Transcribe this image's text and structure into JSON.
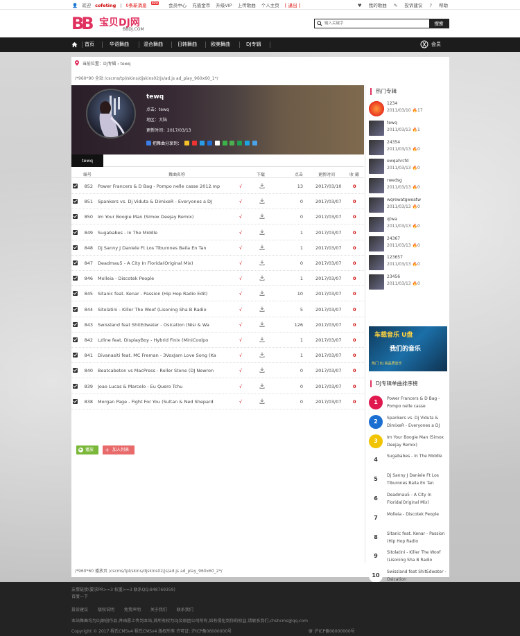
{
  "topbar": {
    "welcome": "欢迎",
    "user": "cofeting",
    "sep": "|",
    "new_msg": "0条新消息",
    "new_badge": "NEW",
    "links": [
      "会员中心",
      "充值金币",
      "升级VIP",
      "上传歌曲",
      "个人主页"
    ],
    "logout": "[ 退出 ]",
    "right": [
      "我的歌曲",
      "投诉建议",
      "帮助"
    ]
  },
  "header": {
    "logo_mark": "BB",
    "logo_cn": "宝贝DJ网",
    "logo_en": "BBDJ.COM",
    "search_placeholder": "输入关键字",
    "search_button": "搜索"
  },
  "nav": {
    "items": [
      "首页",
      "华语舞曲",
      "混合舞曲",
      "日韩舞曲",
      "欧美舞曲",
      "DJ专辑"
    ],
    "member": "会员"
  },
  "breadcrumb": {
    "label": "当前位置：",
    "path": "DJ专辑 › tewq"
  },
  "ad_top": "/*960*90 全站 /cscms/tpl/skins/djskins02/js/ad.js ad_play_960x60_1*/",
  "album": {
    "title": "tewq",
    "clicks": "点击：tewq",
    "region": "地区：大陆",
    "updated": "更新时间：2017/03/13",
    "share_label": "把舞曲分享到：",
    "tab": "tewq"
  },
  "table": {
    "headers": {
      "num": "编号",
      "name": "舞曲名称",
      "dl": "下载",
      "click": "点击",
      "time": "更新时间",
      "fav": "收 藏"
    },
    "rows": [
      {
        "num": "852",
        "name": "Power Francers & D Bag - Pompo nelle casse 2012.mp",
        "check": "√",
        "count": "13",
        "date": "2017/03/10",
        "fav": "0"
      },
      {
        "num": "851",
        "name": "Spankers vs. Dj Viduta & DimixeR - Everyones a DJ",
        "check": "√",
        "count": "0",
        "date": "2017/03/07",
        "fav": "0"
      },
      {
        "num": "850",
        "name": "Im Your Boogie Man (Simox Deejay Remix)",
        "check": "√",
        "count": "0",
        "date": "2017/03/07",
        "fav": "0"
      },
      {
        "num": "849",
        "name": "Sugababes - In The Middle",
        "check": "√",
        "count": "1",
        "date": "2017/03/07",
        "fav": "0"
      },
      {
        "num": "848",
        "name": "Dj Sanny J Daniele Ft Los Tiburones Baila En Tan",
        "check": "√",
        "count": "1",
        "date": "2017/03/07",
        "fav": "0"
      },
      {
        "num": "847",
        "name": "Deadmau5 - A City In Florida(Original Mix)",
        "check": "√",
        "count": "0",
        "date": "2017/03/07",
        "fav": "0"
      },
      {
        "num": "846",
        "name": "Molleia - Discotek People",
        "check": "√",
        "count": "1",
        "date": "2017/03/07",
        "fav": "0"
      },
      {
        "num": "845",
        "name": "Sitanic feat. Kenar - Passion (Hip Hop Radio Edit)",
        "check": "√",
        "count": "10",
        "date": "2017/03/07",
        "fav": "0"
      },
      {
        "num": "844",
        "name": "Sitolatini - Killer The Woof (Lisoning Sha B Radio",
        "check": "√",
        "count": "5",
        "date": "2017/03/07",
        "fav": "0"
      },
      {
        "num": "843",
        "name": "Swissland feat ShitEdwater - Osication (Nisi & Wa",
        "check": "√",
        "count": "126",
        "date": "2017/03/07",
        "fav": "0"
      },
      {
        "num": "842",
        "name": "Lzline feat. DisplayBoy - Hybrid Finix (MiniCoolpo",
        "check": "√",
        "count": "1",
        "date": "2017/03/07",
        "fav": "0"
      },
      {
        "num": "841",
        "name": "Divanasiti feat. MC Freman - 3VoxJam Love Song (Ka",
        "check": "√",
        "count": "1",
        "date": "2017/03/07",
        "fav": "0"
      },
      {
        "num": "840",
        "name": "Beatcabeton vs MacPress - Roller Stone (DJ Newron",
        "check": "√",
        "count": "0",
        "date": "2017/03/07",
        "fav": "0"
      },
      {
        "num": "839",
        "name": "Joao Lucas & Marcelo - Eu Quero Tchu",
        "check": "√",
        "count": "0",
        "date": "2017/03/07",
        "fav": "0"
      },
      {
        "num": "838",
        "name": "Morgan Page - Fight For You (Sultan & Ned Shepard",
        "check": "√",
        "count": "0",
        "date": "2017/03/07",
        "fav": "0"
      }
    ]
  },
  "buttons": {
    "play": "播放",
    "add": "加入列表"
  },
  "ad_bottom": "/*960*60 播放页 /cscms/tpl/skins/djskins02/js/ad.js ad_play_960x60_2*/",
  "sidebar": {
    "hot_title": "热门专辑",
    "albums": [
      {
        "name": "1234",
        "date": "2011/03/10",
        "count": "17"
      },
      {
        "name": "tewq",
        "date": "2011/03/13",
        "count": "1"
      },
      {
        "name": "24354",
        "date": "2011/03/13",
        "count": "0"
      },
      {
        "name": "ewqahrcfd",
        "date": "2011/03/13",
        "count": "0"
      },
      {
        "name": "rwedsg",
        "date": "2011/03/13",
        "count": "0"
      },
      {
        "name": "wqrewatgweatw",
        "date": "2011/03/13",
        "count": "0"
      },
      {
        "name": "qtwa",
        "date": "2011/03/13",
        "count": "0"
      },
      {
        "name": "24367",
        "date": "2011/03/13",
        "count": "0"
      },
      {
        "name": "123657",
        "date": "2011/03/13",
        "count": "0"
      },
      {
        "name": "23456",
        "date": "2011/03/13",
        "count": "0"
      }
    ],
    "ad": {
      "line1": "车载音乐 U盘",
      "line2": "我们的音乐",
      "line3": "热门 DJ 高品质音乐"
    },
    "rank_title": "DJ专辑单曲排序榜",
    "rank": [
      {
        "n": "1",
        "t": "Power Francers & D Bag - Pompo nelle casse",
        "c": "#e0184e"
      },
      {
        "n": "2",
        "t": "Spankers vs. Dj Viduta & DimixeR - Everyones a DJ",
        "c": "#1a6fd1"
      },
      {
        "n": "3",
        "t": "Im Your Boogie Man (Simox Deejay Remix)",
        "c": "#f2c400"
      },
      {
        "n": "4",
        "t": "Sugababes - In The Middle",
        "c": ""
      },
      {
        "n": "5",
        "t": "Dj Sanny J Daniele Ft Los Tiburones Baila En Tan",
        "c": ""
      },
      {
        "n": "6",
        "t": "Deadmau5 - A City In Florida(Original Mix)",
        "c": ""
      },
      {
        "n": "7",
        "t": "Molleia - Discotek People",
        "c": ""
      },
      {
        "n": "8",
        "t": "Sitanic feat. Kenar - Passion (Hip Hop Radio",
        "c": ""
      },
      {
        "n": "9",
        "t": "Sitolatini - Killer The Woof (Lisoning Sha B Radio",
        "c": ""
      },
      {
        "n": "10",
        "t": "Swissland feat ShitEdwater - Osication",
        "c": ""
      }
    ]
  },
  "footer": {
    "line1": "友情链接(要求PR>=3 权重>=3 联系QQ:848769359)",
    "line2": "百度一下",
    "links": [
      "投诉建议",
      "版权说明",
      "免责声明",
      "关于我们",
      "联系我们"
    ],
    "line4": "本站舞曲均为DJ原创作品,并由愿上传到本站,其所有权为DJ及原团公司所有,如有侵犯到你的权益,请联系我们,chshcms@qq.com",
    "line5": "Copyright © 2017 程氏CMSv4 程氏CMSv4 版权所有   许可证: 沪ICP备06000000号",
    "icp": "沪ICP备06000000号"
  }
}
